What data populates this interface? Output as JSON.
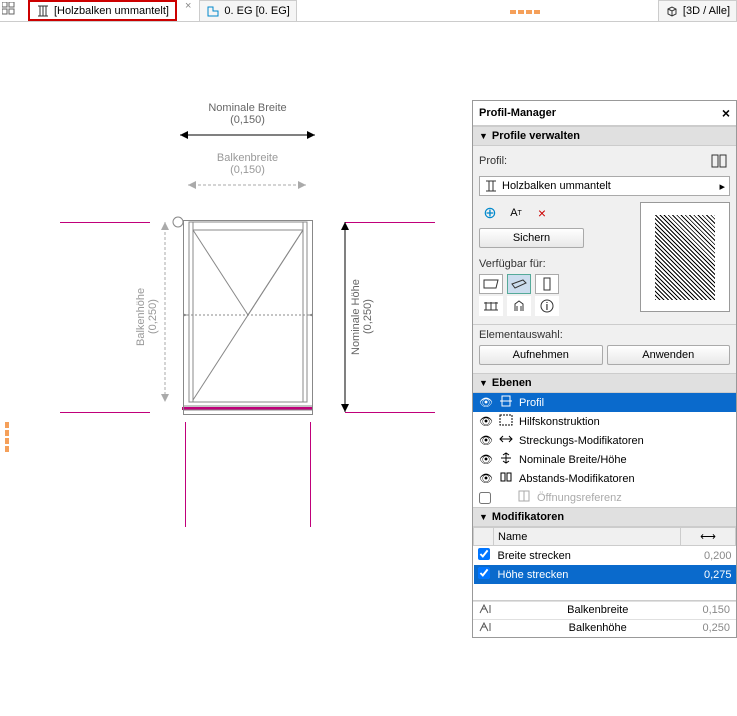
{
  "tabs": {
    "profile_editor": "[Holzbalken ummantelt]",
    "floor": "0. EG [0. EG]",
    "view3d": "[3D / Alle]"
  },
  "drawing": {
    "nominal_width_label": "Nominale Breite",
    "nominal_width_value": "(0,150)",
    "beam_width_label": "Balkenbreite",
    "beam_width_value": "(0,150)",
    "nominal_height_label": "Nominale Höhe",
    "nominal_height_value": "(0,250)",
    "beam_height_label": "Balkenhöhe",
    "beam_height_value": "(0,250)"
  },
  "panel": {
    "title": "Profil-Manager",
    "sect_manage": "Profile verwalten",
    "profile_label": "Profil:",
    "profile_name": "Holzbalken ummantelt",
    "save_btn": "Sichern",
    "available_for": "Verfügbar für:",
    "element_select": "Elementauswahl:",
    "take_btn": "Aufnehmen",
    "apply_btn": "Anwenden",
    "sect_layers": "Ebenen",
    "layers": [
      {
        "name": "Profil",
        "sel": true
      },
      {
        "name": "Hilfskonstruktion"
      },
      {
        "name": "Streckungs-Modifikatoren"
      },
      {
        "name": "Nominale Breite/Höhe"
      },
      {
        "name": "Abstands-Modifikatoren"
      },
      {
        "name": "Öffnungsreferenz",
        "dis": true
      }
    ],
    "sect_mods": "Modifikatoren",
    "mod_name_hdr": "Name",
    "mods": [
      {
        "name": "Breite strecken",
        "val": "0,200",
        "chk": true
      },
      {
        "name": "Höhe strecken",
        "val": "0,275",
        "chk": true,
        "sel": true
      }
    ],
    "params": [
      {
        "name": "Balkenbreite",
        "val": "0,150"
      },
      {
        "name": "Balkenhöhe",
        "val": "0,250"
      }
    ]
  }
}
